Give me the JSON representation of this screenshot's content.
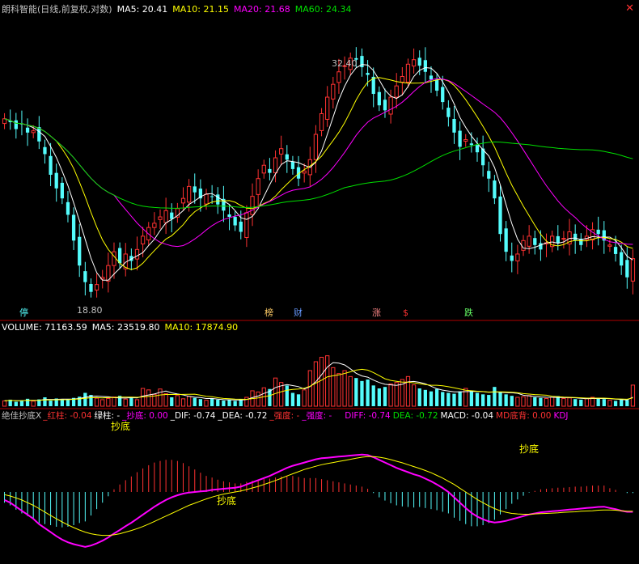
{
  "price_header": {
    "title": "朗科智能(日线,前复权,对数)",
    "ma5": "MA5: 20.41",
    "ma10": "MA10: 21.15",
    "ma20": "MA20: 21.68",
    "ma60": "MA60: 24.34"
  },
  "volume_header": {
    "volume": "VOLUME: 71163.59",
    "ma5": "MA5: 23519.80",
    "ma10": "MA10: 17874.90"
  },
  "indicator_header": {
    "name": "绝佳抄底X",
    "red_bar": "_红柱: -0.04",
    "green_bar": "绿柱: -",
    "bottom": "_抄底: 0.00",
    "dif": "_DIF: -0.74",
    "dea": "_DEA: -0.72",
    "strong": "_强度: -",
    "weak": "_强度: -",
    "diff": "DIFF: -0.74",
    "dea2": "DEA: -0.72",
    "macd": "MACD: -0.04",
    "md": "MD底背: 0.00",
    "kdj": "KDJ"
  },
  "annotations": {
    "high": "32.40",
    "low": "18.80",
    "bottom_label": "抄底"
  },
  "event_badges": [
    "停",
    "榜",
    "财",
    "涨",
    "$",
    "跌"
  ],
  "chart_data": {
    "type": "candlestick",
    "y_scale": "log",
    "price_range": [
      18.0,
      34.0
    ],
    "up_color": "#ff3232",
    "down_color": "#54fcfc",
    "ma_colors": {
      "ma5": "#ffffff",
      "ma10": "#ffff00",
      "ma20": "#ff00ff",
      "ma60": "#00e000"
    },
    "closes": [
      27.5,
      27.3,
      26.9,
      27.2,
      26.7,
      26.8,
      26.2,
      25.5,
      24.4,
      23.7,
      23.2,
      22.4,
      21.2,
      20.1,
      19.4,
      19.0,
      19.3,
      19.6,
      20.1,
      20.7,
      20.2,
      20.6,
      20.3,
      20.8,
      21.4,
      21.8,
      22.0,
      22.3,
      22.6,
      22.2,
      22.7,
      23.2,
      23.8,
      23.5,
      23.2,
      23.4,
      23.3,
      22.9,
      22.6,
      22.3,
      21.9,
      21.6,
      22.5,
      23.3,
      24.2,
      24.9,
      24.5,
      25.3,
      25.8,
      25.2,
      24.7,
      24.2,
      24.6,
      25.2,
      26.6,
      27.8,
      28.8,
      29.6,
      30.4,
      30.8,
      31.3,
      31.2,
      30.7,
      30.2,
      29.0,
      28.3,
      28.0,
      28.8,
      29.5,
      30.1,
      30.9,
      31.2,
      30.8,
      30.4,
      29.9,
      29.2,
      28.5,
      27.6,
      26.7,
      25.9,
      26.3,
      26.0,
      25.6,
      24.9,
      24.2,
      23.2,
      21.5,
      20.7,
      20.3,
      20.6,
      21.2,
      21.4,
      21.0,
      20.8,
      21.1,
      21.4,
      21.1,
      21.3,
      21.6,
      21.2,
      21.0,
      21.4,
      21.7,
      21.5,
      21.2,
      21.0,
      20.6,
      20.1,
      19.6,
      20.4
    ],
    "volume_range": [
      0,
      240000
    ],
    "volumes": [
      18000,
      22000,
      15000,
      20000,
      25000,
      17000,
      23000,
      30000,
      19000,
      26000,
      21000,
      24000,
      28000,
      32000,
      45000,
      38000,
      27000,
      22000,
      26000,
      31000,
      35000,
      24000,
      29000,
      22000,
      60000,
      55000,
      40000,
      58000,
      42000,
      30000,
      36000,
      25000,
      33000,
      28000,
      24000,
      20000,
      26000,
      22000,
      19000,
      21000,
      18000,
      24000,
      30000,
      52000,
      48000,
      62000,
      58000,
      95000,
      80000,
      70000,
      45000,
      40000,
      55000,
      120000,
      150000,
      165000,
      170000,
      130000,
      110000,
      120000,
      100000,
      95000,
      85000,
      90000,
      70000,
      60000,
      65000,
      75000,
      80000,
      90000,
      100000,
      72000,
      60000,
      55000,
      50000,
      58000,
      48000,
      45000,
      42000,
      50000,
      60000,
      52000,
      45000,
      40000,
      38000,
      65000,
      48000,
      40000,
      35000,
      30000,
      32000,
      36000,
      30000,
      28000,
      26000,
      30000,
      34000,
      26000,
      28000,
      24000,
      22000,
      26000,
      30000,
      28000,
      24000,
      20000,
      18000,
      22000,
      21000,
      71164
    ],
    "indicator_range": [
      -2.6,
      2.6
    ],
    "dif": [
      -0.3,
      -0.4,
      -0.55,
      -0.7,
      -0.85,
      -1.0,
      -1.2,
      -1.35,
      -1.5,
      -1.65,
      -1.78,
      -1.88,
      -1.95,
      -2.0,
      -2.05,
      -2.0,
      -1.92,
      -1.82,
      -1.7,
      -1.55,
      -1.42,
      -1.28,
      -1.15,
      -1.0,
      -0.85,
      -0.7,
      -0.55,
      -0.42,
      -0.3,
      -0.2,
      -0.12,
      -0.06,
      -0.02,
      0.0,
      0.02,
      0.04,
      0.08,
      0.1,
      0.12,
      0.14,
      0.16,
      0.2,
      0.28,
      0.36,
      0.44,
      0.52,
      0.6,
      0.7,
      0.8,
      0.9,
      0.98,
      1.04,
      1.1,
      1.16,
      1.22,
      1.26,
      1.28,
      1.3,
      1.32,
      1.34,
      1.36,
      1.38,
      1.4,
      1.38,
      1.3,
      1.2,
      1.1,
      1.0,
      0.9,
      0.82,
      0.74,
      0.66,
      0.6,
      0.5,
      0.4,
      0.28,
      0.15,
      0.0,
      -0.2,
      -0.4,
      -0.6,
      -0.78,
      -0.92,
      -1.02,
      -1.1,
      -1.14,
      -1.12,
      -1.08,
      -1.02,
      -0.96,
      -0.9,
      -0.84,
      -0.8,
      -0.76,
      -0.74,
      -0.72,
      -0.7,
      -0.68,
      -0.66,
      -0.64,
      -0.62,
      -0.6,
      -0.58,
      -0.56,
      -0.55,
      -0.6,
      -0.64,
      -0.7,
      -0.74,
      -0.74
    ],
    "dea": [
      -0.1,
      -0.15,
      -0.22,
      -0.3,
      -0.4,
      -0.5,
      -0.62,
      -0.75,
      -0.88,
      -1.0,
      -1.12,
      -1.23,
      -1.33,
      -1.42,
      -1.5,
      -1.56,
      -1.6,
      -1.62,
      -1.62,
      -1.6,
      -1.56,
      -1.5,
      -1.44,
      -1.37,
      -1.29,
      -1.2,
      -1.1,
      -1.0,
      -0.9,
      -0.8,
      -0.7,
      -0.6,
      -0.5,
      -0.42,
      -0.34,
      -0.26,
      -0.19,
      -0.13,
      -0.08,
      -0.04,
      0.0,
      0.04,
      0.09,
      0.15,
      0.21,
      0.28,
      0.35,
      0.43,
      0.51,
      0.6,
      0.68,
      0.76,
      0.84,
      0.9,
      0.96,
      1.02,
      1.06,
      1.1,
      1.14,
      1.18,
      1.22,
      1.26,
      1.3,
      1.32,
      1.32,
      1.3,
      1.26,
      1.21,
      1.15,
      1.09,
      1.02,
      0.95,
      0.88,
      0.8,
      0.72,
      0.62,
      0.52,
      0.4,
      0.28,
      0.14,
      0.0,
      -0.14,
      -0.28,
      -0.4,
      -0.52,
      -0.62,
      -0.7,
      -0.76,
      -0.8,
      -0.82,
      -0.83,
      -0.83,
      -0.82,
      -0.81,
      -0.8,
      -0.79,
      -0.78,
      -0.76,
      -0.75,
      -0.74,
      -0.72,
      -0.71,
      -0.7,
      -0.68,
      -0.67,
      -0.67,
      -0.68,
      -0.7,
      -0.72,
      -0.72
    ]
  }
}
